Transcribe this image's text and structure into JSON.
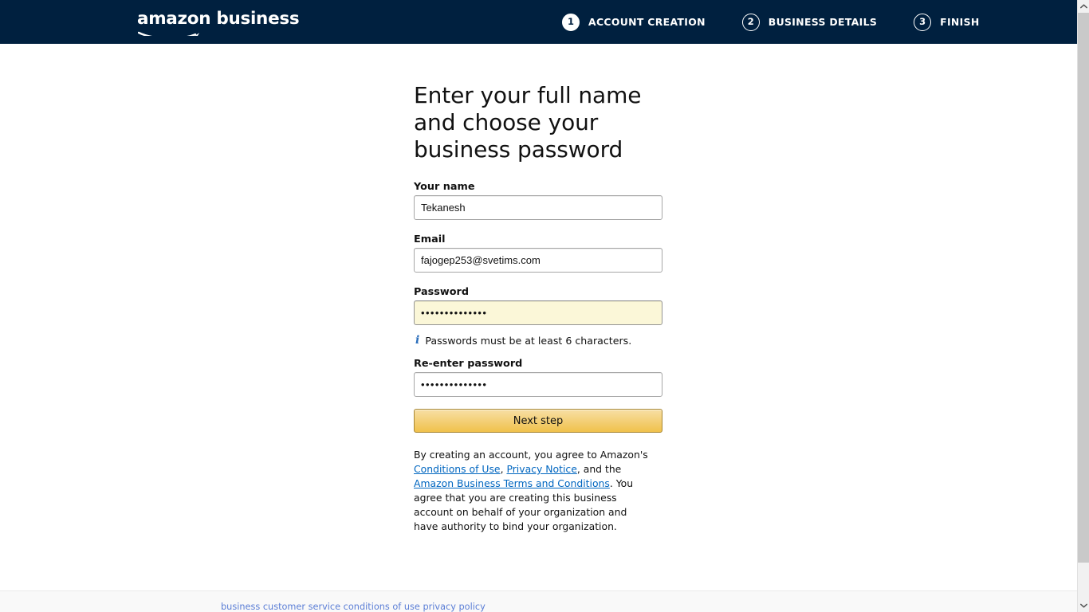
{
  "header": {
    "logo": "amazon business",
    "logo_icon": "amazon-smile-icon",
    "background_color": "#00203f",
    "steps": [
      {
        "number": "1",
        "label": "ACCOUNT CREATION",
        "active": true
      },
      {
        "number": "2",
        "label": "BUSINESS DETAILS",
        "active": false
      },
      {
        "number": "3",
        "label": "FINISH",
        "active": false
      }
    ]
  },
  "main": {
    "title": "Enter your full name and choose your business password",
    "fields": {
      "name": {
        "label": "Your name",
        "value": "Tekanesh",
        "placeholder": ""
      },
      "email": {
        "label": "Email",
        "value": "fajogep253@svetims.com",
        "placeholder": ""
      },
      "password": {
        "label": "Password",
        "value": "••••••••••••••",
        "placeholder": "",
        "autofilled": true,
        "autofill_color": "#fbf7d8"
      },
      "reenter_password": {
        "label": "Re-enter password",
        "value": "••••••••••••••",
        "placeholder": ""
      }
    },
    "hint": {
      "icon": "info-icon",
      "text": "Passwords must be at least 6 characters."
    },
    "submit_button": {
      "label": "Next step",
      "accent_color": "#f0c14b"
    },
    "legal": {
      "part1": "By creating an account, you agree to Amazon's ",
      "link1": "Conditions of Use",
      "sep1": ", ",
      "link2": "Privacy Notice",
      "sep2": ", and the ",
      "link3": "Amazon Business Terms and Conditions",
      "part2": ". You agree that you are creating this business account on behalf of your organization and have authority to bind your organization.",
      "link_color": "#0066c0"
    }
  },
  "footer": {
    "links_text": "business customer service conditions of use privacy policy",
    "link_color": "#5b7ed6"
  },
  "scrollbar": {
    "up_arrow": "chevron-up-icon",
    "down_arrow": "chevron-down-icon"
  }
}
